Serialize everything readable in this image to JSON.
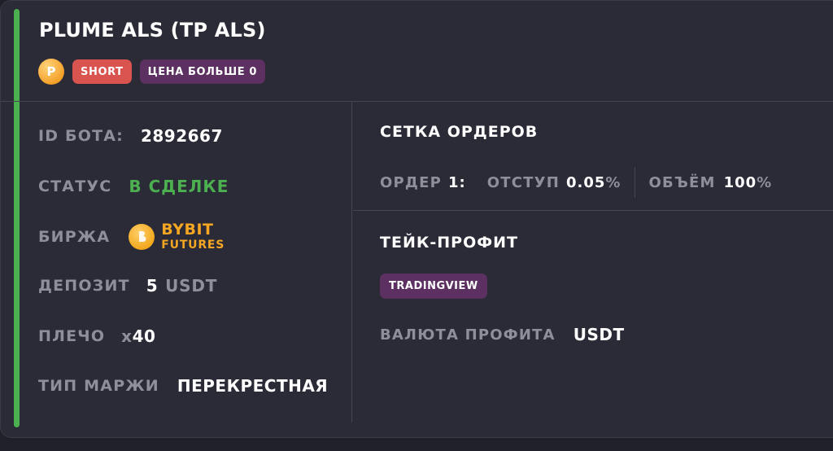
{
  "header": {
    "title": "PLUME ALS (TP ALS)",
    "coin_icon_letter": "P",
    "coin_icon": "plume-coin-icon",
    "side_badge": "SHORT",
    "condition_badge": "ЦЕНА БОЛЬШЕ 0"
  },
  "details": {
    "bot_id_label": "ID БОТА:",
    "bot_id_value": "2892667",
    "status_label": "СТАТУС",
    "status_value": "В СДЕЛКЕ",
    "exchange_label": "БИРЖА",
    "exchange_icon": "bybit-icon",
    "exchange_name": "BYBIT",
    "exchange_sub": "FUTURES",
    "deposit_label": "ДЕПОЗИТ",
    "deposit_amount": "5",
    "deposit_currency": "USDT",
    "leverage_label": "ПЛЕЧО",
    "leverage_prefix": "x",
    "leverage_value": "40",
    "margin_label": "ТИП МАРЖИ",
    "margin_value": "ПЕРЕКРЕСТНАЯ"
  },
  "order_grid": {
    "title": "СЕТКА ОРДЕРОВ",
    "order_label": "ОРДЕР",
    "order_number": "1:",
    "offset_label": "ОТСТУП",
    "offset_value": "0.05",
    "offset_unit": "%",
    "volume_label": "ОБЪЁМ",
    "volume_value": "100",
    "volume_unit": "%"
  },
  "take_profit": {
    "title": "ТЕЙК-ПРОФИТ",
    "source_badge": "TRADINGVIEW",
    "currency_label": "ВАЛЮТА ПРОФИТА",
    "currency_value": "USDT"
  },
  "colors": {
    "accent_green": "#4caf50",
    "short_red": "#d9534f",
    "badge_purple": "#5c3060",
    "bybit_orange": "#f5a623"
  }
}
